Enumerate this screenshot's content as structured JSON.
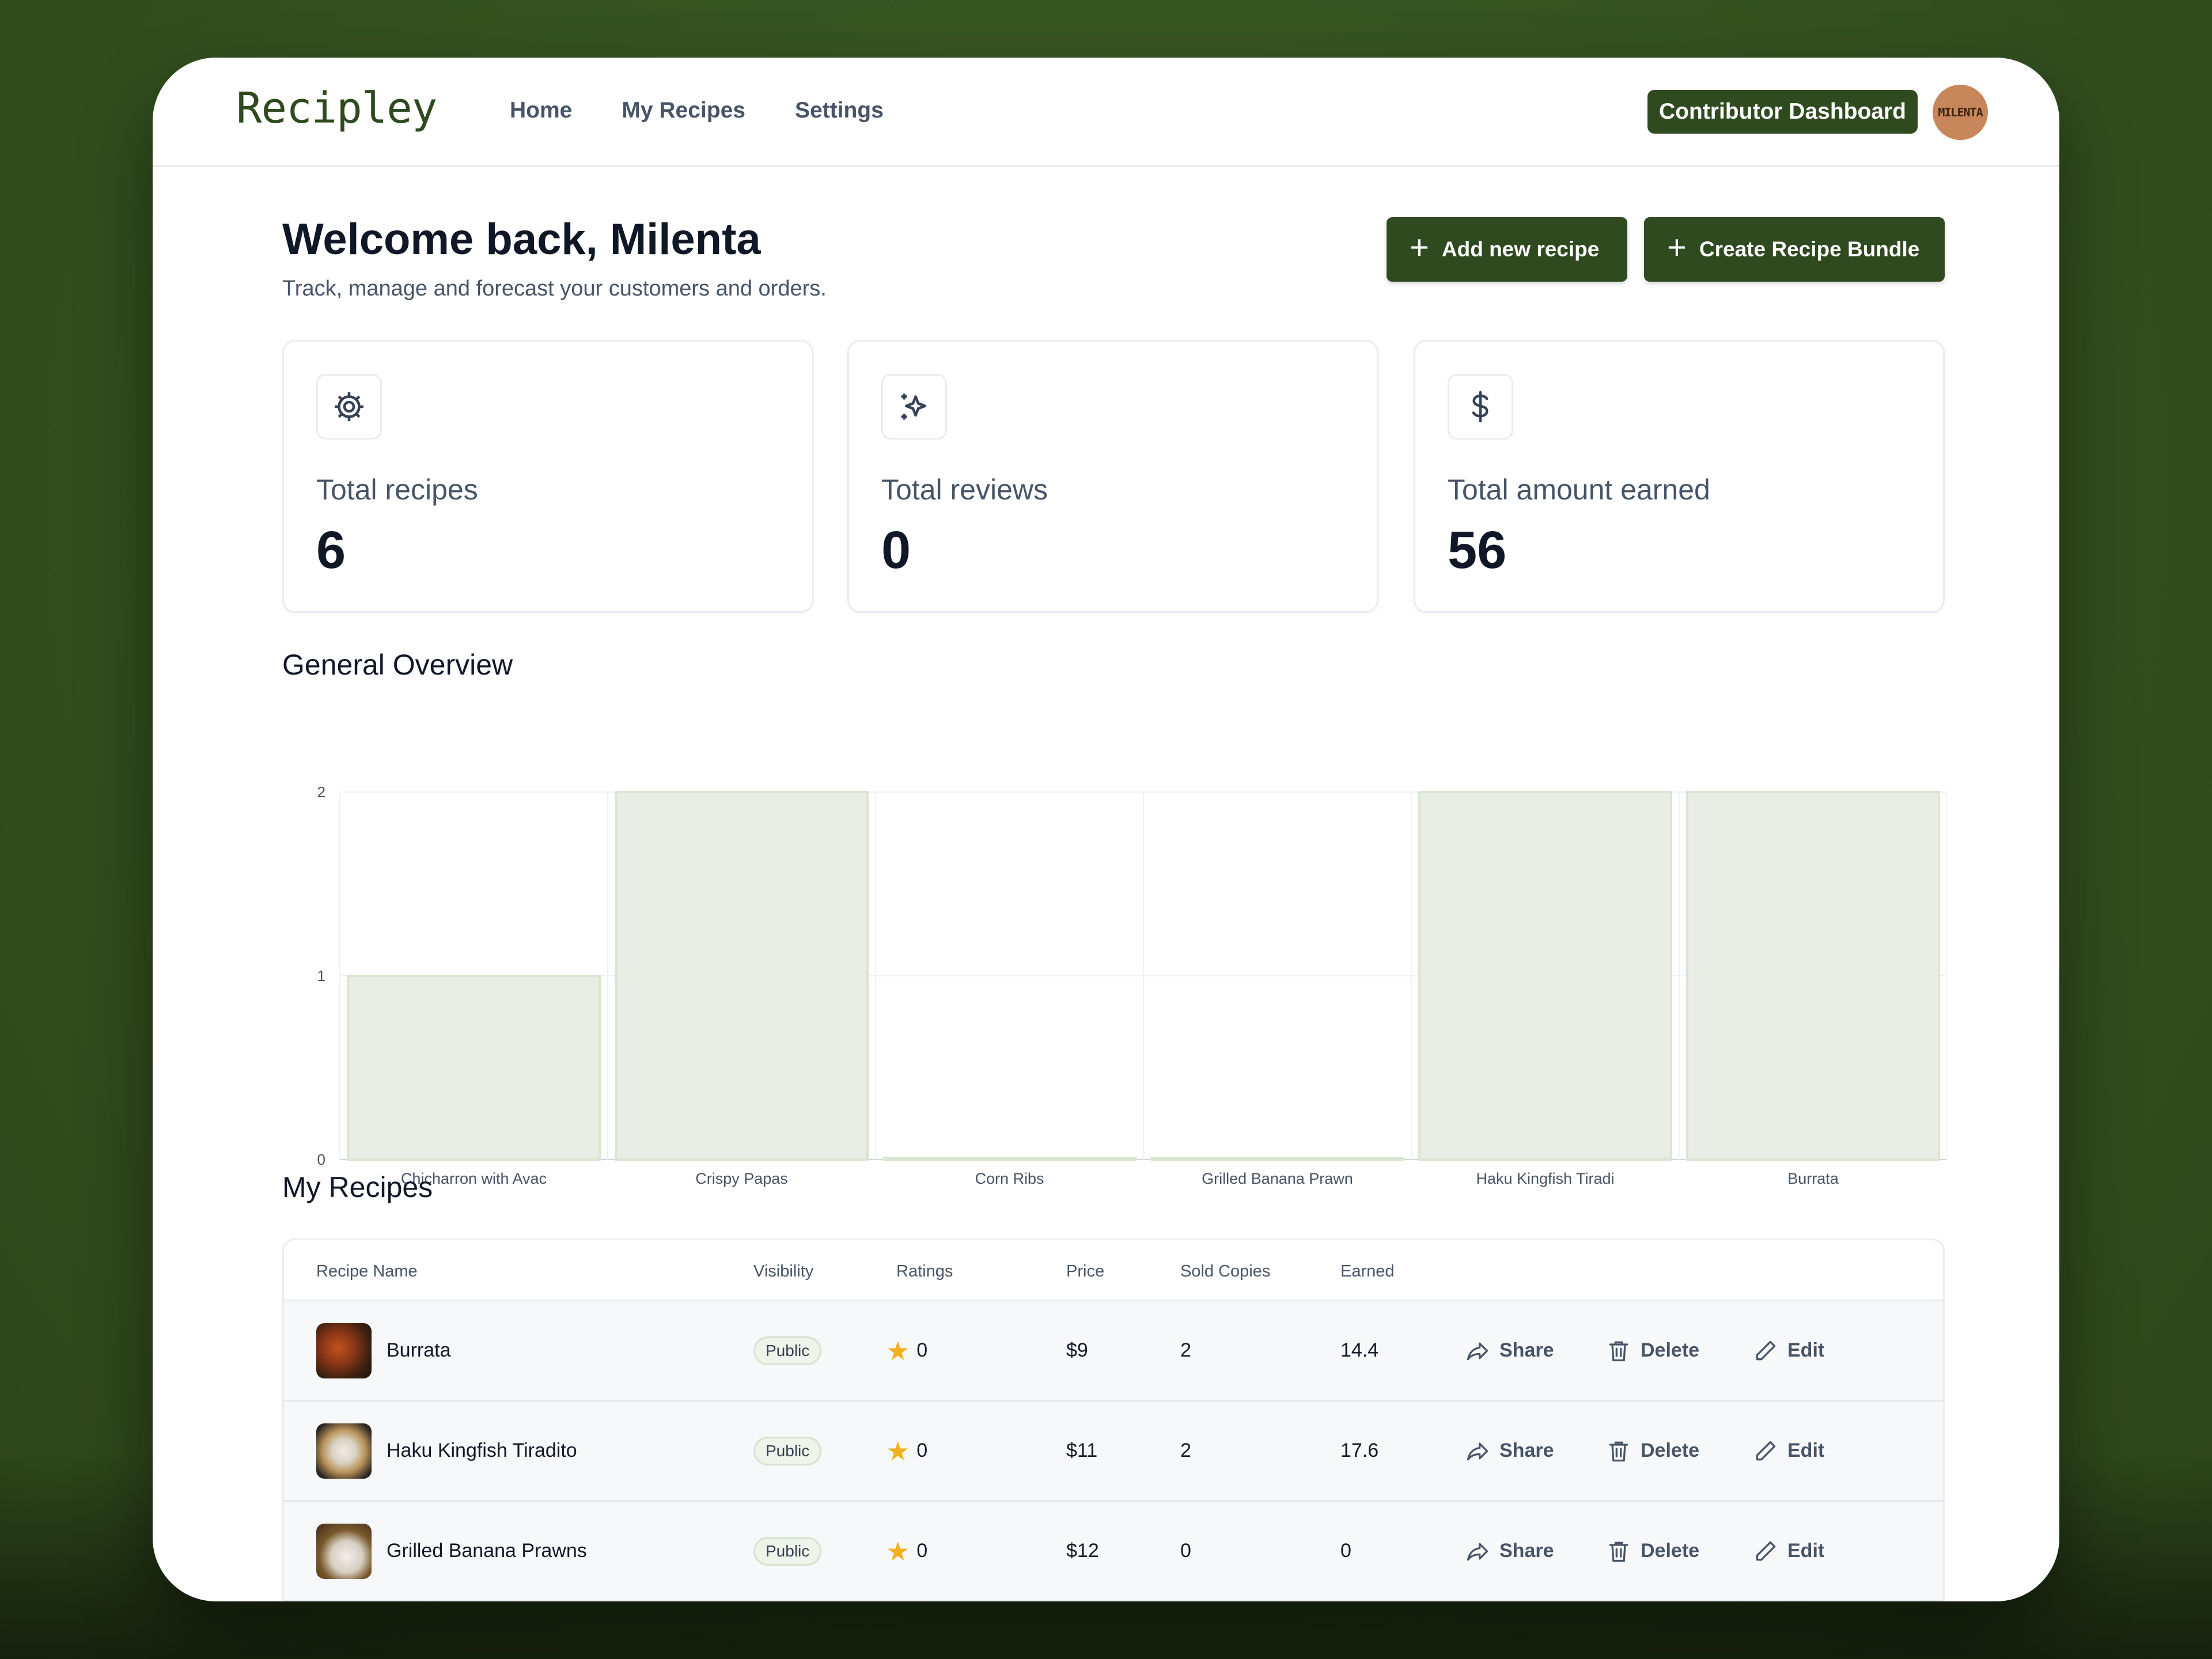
{
  "app": {
    "logo": "Recipley"
  },
  "nav": {
    "items": [
      {
        "label": "Home"
      },
      {
        "label": "My Recipes"
      },
      {
        "label": "Settings"
      }
    ]
  },
  "header": {
    "contributor_button": "Contributor Dashboard",
    "avatar_text": "MILENTA"
  },
  "welcome": {
    "title": "Welcome back, Milenta",
    "subtitle": "Track, manage and forecast your customers and orders.",
    "add_button": "Add new recipe",
    "bundle_button": "Create Recipe Bundle"
  },
  "stats": [
    {
      "label": "Total recipes",
      "value": "6",
      "icon": "gear-icon"
    },
    {
      "label": "Total reviews",
      "value": "0",
      "icon": "sparkles-icon"
    },
    {
      "label": "Total amount earned",
      "value": "56",
      "icon": "dollar-icon"
    }
  ],
  "overview": {
    "title": "General Overview"
  },
  "chart_data": {
    "type": "bar",
    "categories": [
      "Chicharron with Avac",
      "Crispy Papas",
      "Corn Ribs",
      "Grilled Banana Prawn",
      "Haku Kingfish Tiradi",
      "Burrata"
    ],
    "values": [
      1,
      2,
      0,
      0,
      2,
      2
    ],
    "ylim": [
      0,
      2
    ],
    "yticks": [
      0,
      1,
      2
    ],
    "grid": true,
    "bar_color": "#eaece6",
    "bar_stroke": "#d9e6d0"
  },
  "recipes": {
    "title": "My Recipes",
    "columns": {
      "name": "Recipe Name",
      "visibility": "Visibility",
      "ratings": "Ratings",
      "price": "Price",
      "sold": "Sold Copies",
      "earned": "Earned"
    },
    "actions": {
      "share": "Share",
      "delete": "Delete",
      "edit": "Edit"
    },
    "rows": [
      {
        "name": "Burrata",
        "visibility": "Public",
        "rating": "0",
        "price": "$9",
        "sold": "2",
        "earned": "14.4"
      },
      {
        "name": "Haku Kingfish Tiradito",
        "visibility": "Public",
        "rating": "0",
        "price": "$11",
        "sold": "2",
        "earned": "17.6"
      },
      {
        "name": "Grilled Banana Prawns",
        "visibility": "Public",
        "rating": "0",
        "price": "$12",
        "sold": "0",
        "earned": "0"
      }
    ]
  },
  "colors": {
    "brand": "#2f4a1f",
    "background": "#34511f",
    "star": "#f2b01e"
  }
}
